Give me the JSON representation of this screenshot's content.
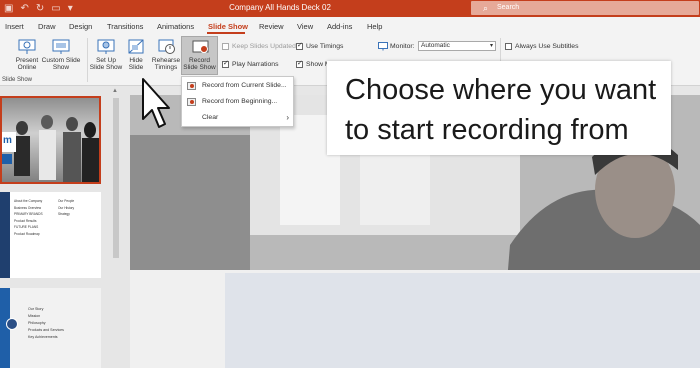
{
  "titlebar": {
    "doc_title": "Company All Hands Deck 02",
    "search_placeholder": "Search",
    "qat_icons": [
      "save-icon",
      "undo-icon",
      "redo-icon",
      "start-from-beginning-icon",
      "customize-qat-icon"
    ]
  },
  "tabs": [
    "Insert",
    "Draw",
    "Design",
    "Transitions",
    "Animations",
    "Slide Show",
    "Review",
    "View",
    "Add-ins",
    "Help"
  ],
  "active_tab": "Slide Show",
  "ribbon": {
    "present_online": "Present Online",
    "custom_slide_show": "Custom Slide Show",
    "set_up_slide_show": "Set Up Slide Show",
    "hide_slide": "Hide Slide",
    "rehearse_timings": "Rehearse Timings",
    "record_slide_show": "Record Slide Show",
    "keep_slides_updated": "Keep Slides Updated",
    "play_narrations": "Play Narrations",
    "use_timings": "Use Timings",
    "show_media": "Show M",
    "monitor_label": "Monitor:",
    "monitor_value": "Automatic",
    "always_use_subtitles": "Always Use Subtitles",
    "group_label": "Slide Show"
  },
  "checkboxes": {
    "keep_slides_updated": false,
    "play_narrations": true,
    "use_timings": true,
    "show_media": true,
    "always_use_subtitles": false
  },
  "record_menu": {
    "from_current": "Record from Current Slide...",
    "from_beginning": "Record from Beginning...",
    "clear": "Clear"
  },
  "thumbnails": {
    "slide1_title_fragment": "m",
    "slide2_col1": [
      "About the Company",
      "Business Overview",
      "PRIMARY BRANDS",
      "Product Results",
      "FUTURE PLANS",
      "Product Roadmap"
    ],
    "slide2_col2": [
      "Our People",
      "Our History",
      "Strategy"
    ],
    "slide3_list": [
      "Our Story",
      "Mission",
      "Philosophy",
      "Products and Services",
      "Key Achievements"
    ]
  },
  "callout": {
    "text": "Choose where you want to start recording from"
  },
  "colors": {
    "accent": "#c43e1c",
    "ribbon_bg": "#f3f3f3",
    "slide_blue": "#1f5fa8"
  }
}
